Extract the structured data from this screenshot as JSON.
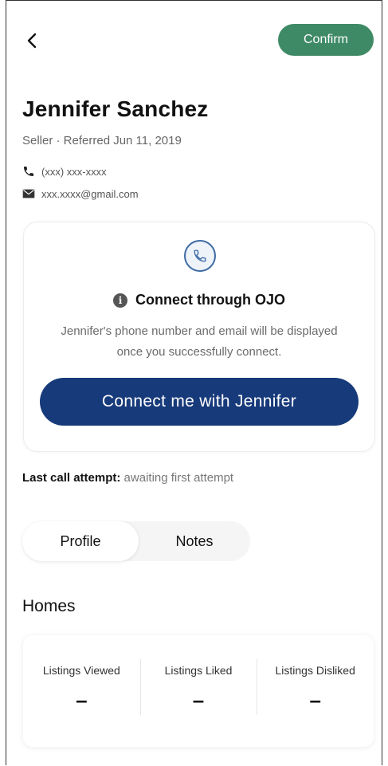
{
  "header": {
    "back_icon": "chevron-left-icon",
    "confirm_label": "Confirm"
  },
  "contact": {
    "name": "Jennifer Sanchez",
    "subtitle": "Seller · Referred Jun 11, 2019",
    "phone": "(xxx) xxx-xxxx",
    "email": "xxx.xxxx@gmail.com"
  },
  "connect_card": {
    "icon": "phone-icon",
    "title": "Connect through OJO",
    "description": "Jennifer's phone number and email will be displayed once you successfully connect.",
    "button_label": "Connect me with Jennifer"
  },
  "last_call": {
    "label": "Last call attempt:",
    "value": "awaiting first attempt"
  },
  "tabs": [
    {
      "label": "Profile",
      "active": true
    },
    {
      "label": "Notes",
      "active": false
    }
  ],
  "homes": {
    "title": "Homes",
    "stats": [
      {
        "label": "Listings Viewed",
        "value": "–"
      },
      {
        "label": "Listings Liked",
        "value": "–"
      },
      {
        "label": "Listings Disliked",
        "value": "–"
      }
    ]
  },
  "colors": {
    "confirm": "#3f8a66",
    "primary": "#173a7a",
    "icon_blue": "#3d6aa6"
  }
}
